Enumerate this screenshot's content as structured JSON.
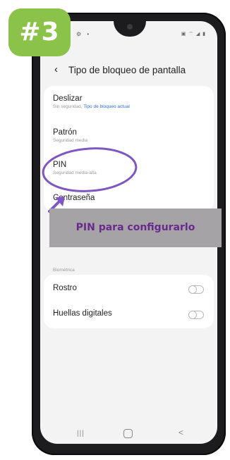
{
  "badge": {
    "text": "#3"
  },
  "status_bar": {
    "left": "• ⚙ •",
    "right": "▣ ⌔ ◢ ▮"
  },
  "header": {
    "title": "Tipo de bloqueo de pantalla"
  },
  "lock_options": [
    {
      "title": "Deslizar",
      "subtitle": "Sin seguridad, ",
      "subtitle_link": "Tipo de bloqueo actual"
    },
    {
      "title": "Patrón",
      "subtitle": "Seguridad media"
    },
    {
      "title": "PIN",
      "subtitle": "Seguridad media-alta"
    },
    {
      "title": "Contraseña",
      "subtitle": ""
    }
  ],
  "banner": {
    "text": "PIN para configurarlo"
  },
  "biometrics": {
    "section_label": "Biométrica",
    "items": [
      {
        "title": "Rostro",
        "enabled": false
      },
      {
        "title": "Huellas digitales",
        "enabled": false
      }
    ]
  },
  "navbar": {
    "recent": "|||",
    "back": "<"
  },
  "colors": {
    "badge": "#8bc34a",
    "banner_bg": "#a5a3a6",
    "banner_text": "#6a2a8c",
    "annotation": "#7e57c2",
    "link": "#2a6fdb"
  }
}
